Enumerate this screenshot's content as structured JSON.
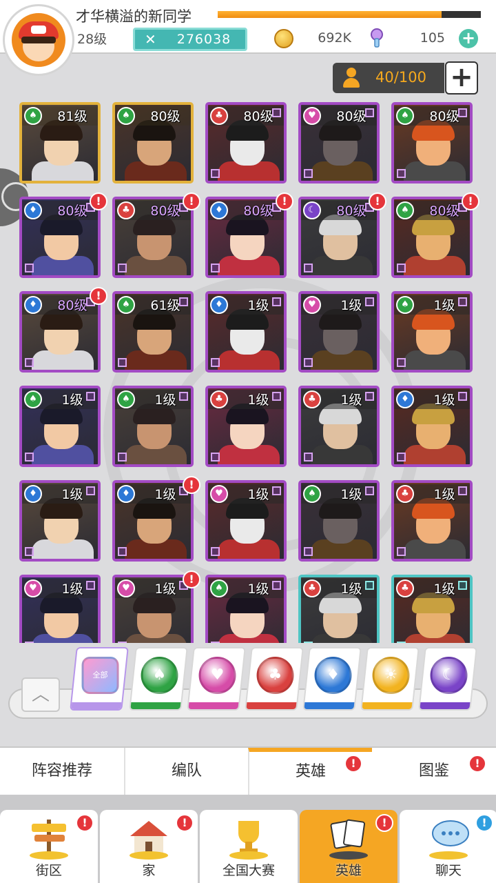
{
  "player": {
    "name": "才华横溢的新同学",
    "level": "28级",
    "exp_progress": 0.85,
    "power": "276038",
    "gold": "692K",
    "gems": "105"
  },
  "capacity": {
    "text": "40/100"
  },
  "heroes": [
    {
      "level": "81级",
      "faction": "green",
      "frame": "gold"
    },
    {
      "level": "80级",
      "faction": "green",
      "frame": "gold"
    },
    {
      "level": "80级",
      "faction": "red",
      "frame": "purple"
    },
    {
      "level": "80级",
      "faction": "pink",
      "frame": "purple"
    },
    {
      "level": "80级",
      "faction": "green",
      "frame": "purple"
    },
    {
      "level": "80级",
      "faction": "blue",
      "frame": "purple",
      "alert": true
    },
    {
      "level": "80级",
      "faction": "red",
      "frame": "purple",
      "alert": true
    },
    {
      "level": "80级",
      "faction": "blue",
      "frame": "purple",
      "alert": true
    },
    {
      "level": "80级",
      "faction": "purple",
      "frame": "purple",
      "alert": true
    },
    {
      "level": "80级",
      "faction": "green",
      "frame": "purple",
      "alert": true
    },
    {
      "level": "80级",
      "faction": "blue",
      "frame": "purple",
      "alert": true
    },
    {
      "level": "61级",
      "faction": "green",
      "frame": "purple"
    },
    {
      "level": "1级",
      "faction": "blue",
      "frame": "purple"
    },
    {
      "level": "1级",
      "faction": "pink",
      "frame": "purple"
    },
    {
      "level": "1级",
      "faction": "green",
      "frame": "purple"
    },
    {
      "level": "1级",
      "faction": "green",
      "frame": "purple"
    },
    {
      "level": "1级",
      "faction": "green",
      "frame": "purple"
    },
    {
      "level": "1级",
      "faction": "red",
      "frame": "purple"
    },
    {
      "level": "1级",
      "faction": "red",
      "frame": "purple"
    },
    {
      "level": "1级",
      "faction": "blue",
      "frame": "purple"
    },
    {
      "level": "1级",
      "faction": "blue",
      "frame": "purple"
    },
    {
      "level": "1级",
      "faction": "blue",
      "frame": "purple",
      "alert": true
    },
    {
      "level": "1级",
      "faction": "pink",
      "frame": "purple"
    },
    {
      "level": "1级",
      "faction": "green",
      "frame": "purple"
    },
    {
      "level": "1级",
      "faction": "red",
      "frame": "purple"
    },
    {
      "level": "1级",
      "faction": "pink",
      "frame": "purple"
    },
    {
      "level": "1级",
      "faction": "pink",
      "frame": "purple",
      "alert": true
    },
    {
      "level": "1级",
      "faction": "green",
      "frame": "purple"
    },
    {
      "level": "1级",
      "faction": "red",
      "frame": "teal"
    },
    {
      "level": "1级",
      "faction": "red",
      "frame": "teal"
    }
  ],
  "filters": [
    {
      "label": "全部",
      "color": "#b796ea",
      "icon": "all-icon"
    },
    {
      "color": "#2fa344",
      "icon": "spade-icon"
    },
    {
      "color": "#d64ca8",
      "icon": "heart-icon"
    },
    {
      "color": "#d9413f",
      "icon": "club-icon"
    },
    {
      "color": "#2d78d6",
      "icon": "diamond-icon"
    },
    {
      "color": "#f2b320",
      "icon": "sun-icon"
    },
    {
      "color": "#7a44c8",
      "icon": "moon-icon"
    }
  ],
  "subnav": {
    "tabs": [
      {
        "label": "阵容推荐"
      },
      {
        "label": "编队"
      },
      {
        "label": "英雄",
        "active": true,
        "alert": true
      },
      {
        "label": "图鉴",
        "alert": true
      }
    ]
  },
  "bottomnav": {
    "items": [
      {
        "label": "街区",
        "alert": true
      },
      {
        "label": "家",
        "alert": true
      },
      {
        "label": "全国大赛"
      },
      {
        "label": "英雄",
        "active": true,
        "alert": true
      },
      {
        "label": "聊天",
        "info": true
      }
    ]
  },
  "colors": {
    "accent": "#f5a623",
    "alert": "#e5353b",
    "power": "#44b7b2",
    "frame_purple": "#a34bc4",
    "frame_gold": "#e3b23c",
    "frame_teal": "#4fc5c4"
  }
}
